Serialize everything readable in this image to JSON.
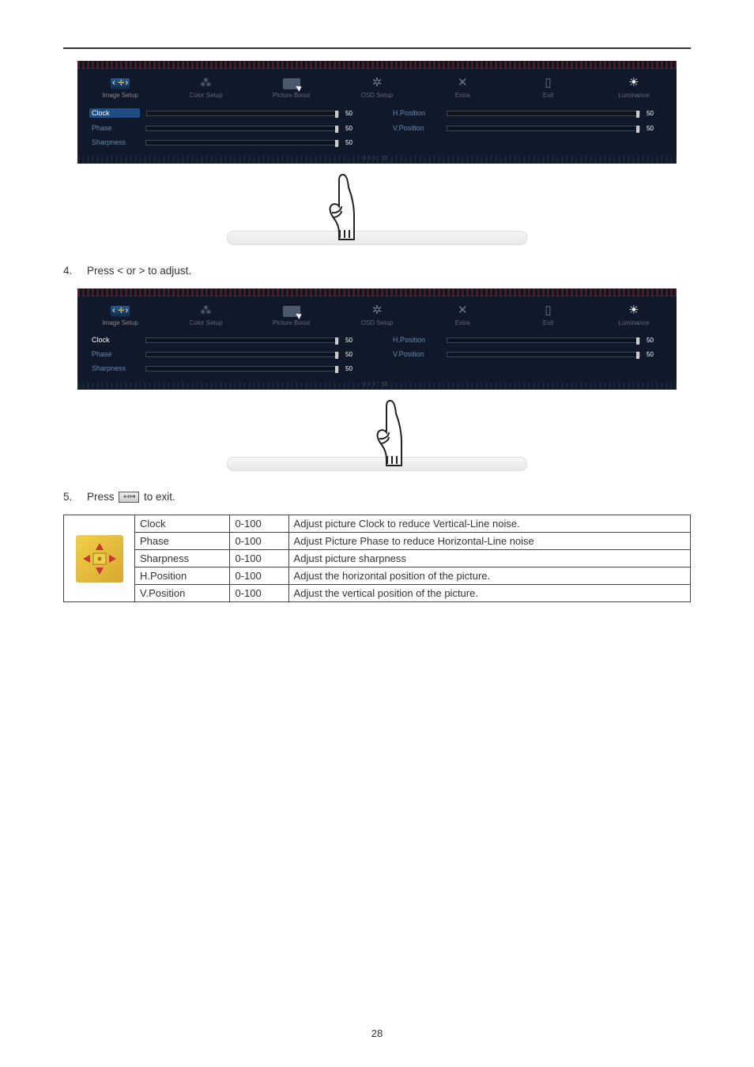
{
  "osd_tabs": {
    "image_setup": "Image Setup",
    "color_setup": "Color Setup",
    "picture_boost": "Picture Boost",
    "osd_setup": "OSD Setup",
    "extra": "Extra",
    "exit": "Exit",
    "luminance": "Luminance"
  },
  "osd_bottom_text": "III O",
  "osd1": {
    "left": [
      {
        "label": "Clock",
        "value": "50"
      },
      {
        "label": "Phase",
        "value": "50"
      },
      {
        "label": "Sharpness",
        "value": "50"
      }
    ],
    "right": [
      {
        "label": "H.Position",
        "value": "50"
      },
      {
        "label": "V.Position",
        "value": "50"
      }
    ]
  },
  "osd2": {
    "left": [
      {
        "label": "Clock",
        "value": "50"
      },
      {
        "label": "Phase",
        "value": "50"
      },
      {
        "label": "Sharpness",
        "value": "50"
      }
    ],
    "right": [
      {
        "label": "H.Position",
        "value": "50"
      },
      {
        "label": "V.Position",
        "value": "50"
      }
    ]
  },
  "step4": {
    "num": "4.",
    "text": "Press < or > to adjust."
  },
  "step5": {
    "num": "5.",
    "text_before": "Press ",
    "text_after": " to exit."
  },
  "table": {
    "rows": [
      {
        "name": "Clock",
        "range": "0-100",
        "desc": "Adjust picture Clock to reduce Vertical-Line noise."
      },
      {
        "name": "Phase",
        "range": "0-100",
        "desc": "Adjust Picture Phase to reduce Horizontal-Line noise"
      },
      {
        "name": "Sharpness",
        "range": "0-100",
        "desc": "Adjust picture sharpness"
      },
      {
        "name": "H.Position",
        "range": "0-100",
        "desc": "Adjust the horizontal position of the picture."
      },
      {
        "name": "V.Position",
        "range": "0-100",
        "desc": "Adjust the vertical position of the picture."
      }
    ]
  },
  "page_number": "28"
}
